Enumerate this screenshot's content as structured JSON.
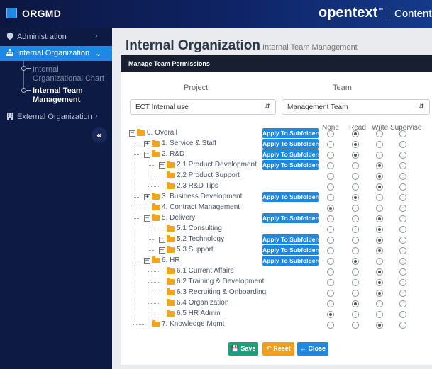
{
  "app": {
    "name": "ORGMD"
  },
  "brand": {
    "name": "opentext",
    "tm": "™",
    "suffix": "Content Se"
  },
  "sidebar": {
    "items": [
      {
        "label": "Administration",
        "icon": "shield-icon"
      },
      {
        "label": "Internal Organization",
        "icon": "org-chart-icon"
      },
      {
        "label": "External Organization",
        "icon": "building-icon"
      }
    ],
    "subitems": [
      {
        "label": "Internal Organizational Chart"
      },
      {
        "label": "Internal Team Management"
      }
    ],
    "collapse_glyph": "«"
  },
  "page": {
    "title": "Internal Organization",
    "subtitle": "Internal Team Management"
  },
  "card": {
    "header": "Manage Team Permissions",
    "project_label": "Project",
    "team_label": "Team",
    "project_value": "ECT Internal use",
    "team_value": "Management Team",
    "perm_headers": [
      "None",
      "Read",
      "Write",
      "Supervise"
    ],
    "apply_label": "Apply To Subfolders"
  },
  "tree": [
    {
      "label": "0. Overall",
      "toggle": "-",
      "apply": true,
      "perm": 1
    },
    {
      "label": "1. Service & Staff",
      "toggle": "+",
      "apply": true,
      "perm": 1
    },
    {
      "label": "2. R&D",
      "toggle": "-",
      "apply": true,
      "perm": 1
    },
    {
      "label": "2.1 Product Development",
      "toggle": "+",
      "apply": true,
      "perm": 2
    },
    {
      "label": "2.2 Product Support",
      "toggle": "",
      "apply": false,
      "perm": 2
    },
    {
      "label": "2.3 R&D Tips",
      "toggle": "",
      "apply": false,
      "perm": 2
    },
    {
      "label": "3. Business Development",
      "toggle": "+",
      "apply": true,
      "perm": 1
    },
    {
      "label": "4. Contract Management",
      "toggle": "",
      "apply": false,
      "perm": 0
    },
    {
      "label": "5. Delivery",
      "toggle": "-",
      "apply": true,
      "perm": 2
    },
    {
      "label": "5.1 Consulting",
      "toggle": "",
      "apply": false,
      "perm": 2
    },
    {
      "label": "5.2 Technology",
      "toggle": "+",
      "apply": true,
      "perm": 2
    },
    {
      "label": "5.3 Support",
      "toggle": "+",
      "apply": true,
      "perm": 2
    },
    {
      "label": "6. HR",
      "toggle": "-",
      "apply": true,
      "perm": 1
    },
    {
      "label": "6.1 Current Affairs",
      "toggle": "",
      "apply": false,
      "perm": 2
    },
    {
      "label": "6.2 Training & Development",
      "toggle": "",
      "apply": false,
      "perm": 2
    },
    {
      "label": "6.3 Recruiting & Onboarding",
      "toggle": "",
      "apply": false,
      "perm": 2
    },
    {
      "label": "6.4 Organization",
      "toggle": "",
      "apply": false,
      "perm": 1
    },
    {
      "label": "6.5 HR Admin",
      "toggle": "",
      "apply": false,
      "perm": 0
    },
    {
      "label": "7. Knowledge Mgmt",
      "toggle": "",
      "apply": false,
      "perm": 2
    }
  ],
  "buttons": {
    "save": "Save",
    "reset": "Reset",
    "close": "Close"
  },
  "colors": {
    "accent": "#1e88e5",
    "save": "#1aa179",
    "reset": "#f59d1a",
    "sidebar": "#0d1a44",
    "folder": "#f2a51c"
  }
}
